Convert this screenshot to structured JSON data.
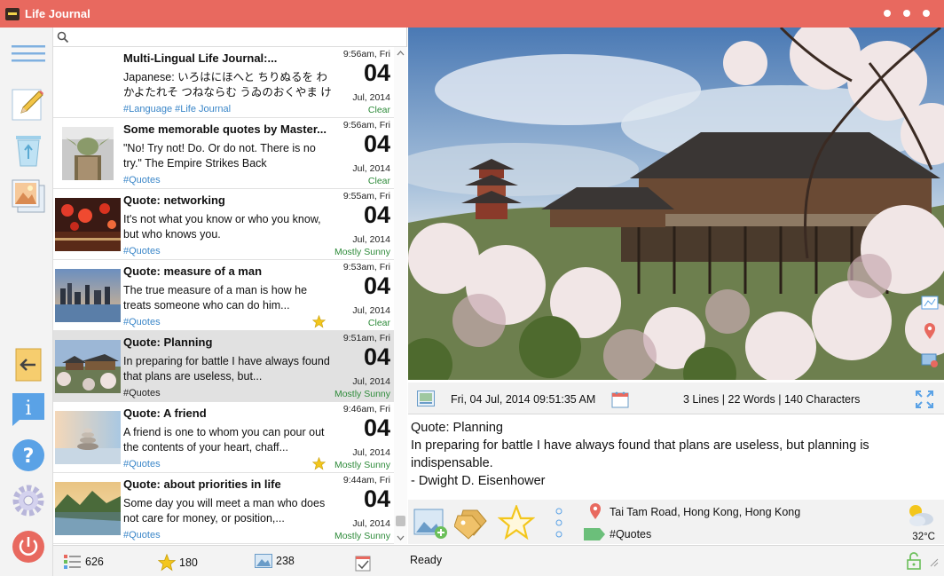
{
  "app": {
    "title": "Life Journal"
  },
  "search": {
    "placeholder": ""
  },
  "entries": [
    {
      "title": "Multi-Lingual Life Journal:...",
      "text": "Japanese: いろはにほへと ちりぬるを わかよたれそ つねならむ うゐのおくやま けふこえて あ...",
      "tags": "#Language #Life Journal",
      "time": "9:56am, Fri",
      "day": "04",
      "month": "Jul, 2014",
      "weather": "Clear",
      "starred": false,
      "thumb": "none"
    },
    {
      "title": "Some memorable quotes by Master...",
      "text": "\"No! Try not! Do. Or do not. There is no try.\" The Empire Strikes Back",
      "tags": "#Quotes",
      "time": "9:56am, Fri",
      "day": "04",
      "month": "Jul, 2014",
      "weather": "Clear",
      "starred": false,
      "thumb": "yoda"
    },
    {
      "title": "Quote: networking",
      "text": "It's not what you know or who you know, but who knows you.",
      "tags": "#Quotes",
      "time": "9:55am, Fri",
      "day": "04",
      "month": "Jul, 2014",
      "weather": "Mostly Sunny",
      "starred": false,
      "thumb": "lanterns"
    },
    {
      "title": "Quote: measure of a man",
      "text": "The true measure of a man is how he treats someone who can do him...",
      "tags": "#Quotes",
      "time": "9:53am, Fri",
      "day": "04",
      "month": "Jul, 2014",
      "weather": "Clear",
      "starred": true,
      "thumb": "city"
    },
    {
      "title": "Quote: Planning",
      "text": "In preparing for battle I have always found that plans are useless, but...",
      "tags": "#Quotes",
      "time": "9:51am, Fri",
      "day": "04",
      "month": "Jul, 2014",
      "weather": "Mostly Sunny",
      "starred": false,
      "thumb": "temple"
    },
    {
      "title": "Quote: A friend",
      "text": "A friend is one to whom you can pour out the contents of your heart, chaff...",
      "tags": "#Quotes",
      "time": "9:46am, Fri",
      "day": "04",
      "month": "Jul, 2014",
      "weather": "Mostly Sunny",
      "starred": true,
      "thumb": "stones"
    },
    {
      "title": "Quote: about priorities in life",
      "text": "Some day you will meet a man who does not care for money, or position,...",
      "tags": "#Quotes",
      "time": "9:44am, Fri",
      "day": "04",
      "month": "Jul, 2014",
      "weather": "Mostly Sunny",
      "starred": false,
      "thumb": "lake"
    }
  ],
  "infobar": {
    "date": "Fri, 04 Jul, 2014 09:51:35 AM",
    "stats": "3 Lines | 22 Words | 140 Characters"
  },
  "editor": {
    "lines": [
      "Quote: Planning",
      "In preparing for battle I have always found that plans are useless, but planning is indispensable.",
      "- Dwight D. Eisenhower"
    ]
  },
  "props": {
    "location": "Tai Tam Road, Hong Kong, Hong Kong",
    "tags": "#Quotes",
    "temperature": "32°C"
  },
  "status": {
    "entries_count": "626",
    "starred_count": "180",
    "photos_count": "238",
    "state": "Ready"
  },
  "colors": {
    "accent": "#e8695f",
    "link": "#3a86c8",
    "weather": "#2e8b3a"
  }
}
